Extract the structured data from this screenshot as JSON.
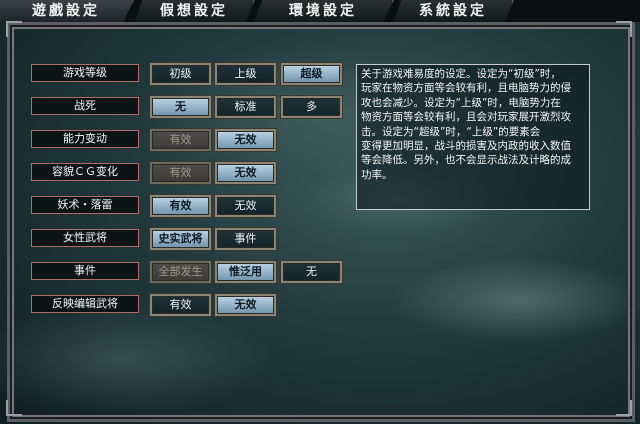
{
  "tabs": [
    "遊戲設定",
    "假想設定",
    "環境設定",
    "系統設定"
  ],
  "rows": [
    {
      "label": "游戏等级",
      "options": [
        "初级",
        "上级",
        "超级"
      ],
      "selected": 2,
      "disabled": []
    },
    {
      "label": "战死",
      "options": [
        "无",
        "标准",
        "多"
      ],
      "selected": 0,
      "disabled": []
    },
    {
      "label": "能力变动",
      "options": [
        "有效",
        "无效"
      ],
      "selected": 1,
      "disabled": [
        0
      ]
    },
    {
      "label": "容貌ＣＧ变化",
      "options": [
        "有效",
        "无效"
      ],
      "selected": 1,
      "disabled": [
        0
      ]
    },
    {
      "label": "妖术・落雷",
      "options": [
        "有效",
        "无效"
      ],
      "selected": 0,
      "disabled": []
    },
    {
      "label": "女性武将",
      "options": [
        "史实武将",
        "事件"
      ],
      "selected": 0,
      "disabled": []
    },
    {
      "label": "事件",
      "options": [
        "全部发生",
        "惟泛用",
        "无"
      ],
      "selected": 1,
      "disabled": [
        0
      ]
    },
    {
      "label": "反映编辑武将",
      "options": [
        "有效",
        "无效"
      ],
      "selected": 1,
      "disabled": []
    }
  ],
  "description": "关于游戏难易度的设定。设定为“初级”时，\n玩家在物资方面等会较有利，且电脑势力的侵\n攻也会减少。设定为“上级”时，电脑势力在\n物资方面等会较有利，且会对玩家展开激烈攻\n击。设定为“超级”时，“上级”的要素会\n变得更加明显，战斗的损害及内政的收入数值\n等会降低。另外，也不会显示战法及计略的成\n功率。",
  "colors": {
    "selected": "#a9c6dc",
    "label_border": "#b56a6a",
    "disabled": "#4e4d49"
  }
}
